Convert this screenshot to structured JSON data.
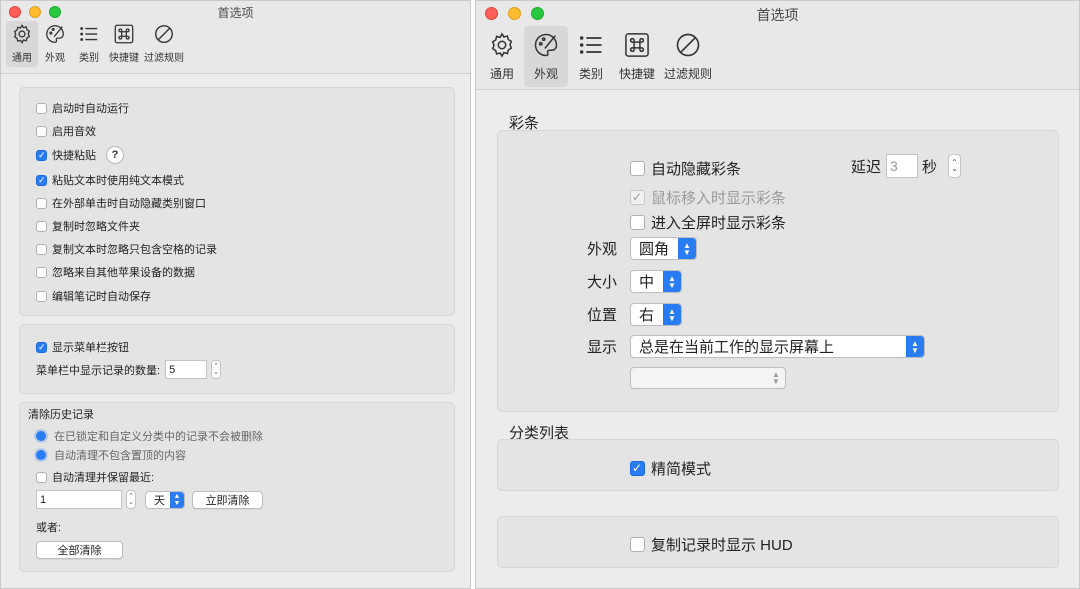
{
  "left": {
    "title": "首选项",
    "tabs": [
      {
        "label": "通用",
        "icon": "gear-icon"
      },
      {
        "label": "外观",
        "icon": "brush-palette-icon"
      },
      {
        "label": "类别",
        "icon": "list-icon"
      },
      {
        "label": "快捷键",
        "icon": "command-key-icon"
      },
      {
        "label": "过滤规则",
        "icon": "prohibited-icon"
      }
    ],
    "active_tab": "通用",
    "general": [
      {
        "label": "启动时自动运行",
        "checked": false
      },
      {
        "label": "启用音效",
        "checked": false
      },
      {
        "label": "快捷粘贴",
        "checked": true,
        "help": "?"
      },
      {
        "label": "粘贴文本时使用纯文本模式",
        "checked": true
      },
      {
        "label": "在外部单击时自动隐藏类别窗口",
        "checked": false
      },
      {
        "label": "复制时忽略文件夹",
        "checked": false
      },
      {
        "label": "复制文本时忽略只包含空格的记录",
        "checked": false
      },
      {
        "label": "忽略来自其他苹果设备的数据",
        "checked": false
      },
      {
        "label": "编辑笔记时自动保存",
        "checked": false
      }
    ],
    "menubar": {
      "show_label": "显示菜单栏按钮",
      "show_checked": true,
      "count_label": "菜单栏中显示记录的数量:",
      "count_value": "5"
    },
    "history": {
      "title": "清除历史记录",
      "note1": "在已锁定和自定义分类中的记录不会被删除",
      "note2": "自动清理不包含置顶的内容",
      "auto_label": "自动清理并保留最近:",
      "auto_checked": false,
      "keep_value": "1",
      "unit_value": "天",
      "clear_now_label": "立即清除",
      "or_label": "或者:",
      "clear_all_label": "全部清除"
    }
  },
  "right": {
    "title": "首选项",
    "tabs": [
      {
        "label": "通用",
        "icon": "gear-icon"
      },
      {
        "label": "外观",
        "icon": "brush-palette-icon"
      },
      {
        "label": "类别",
        "icon": "list-icon"
      },
      {
        "label": "快捷键",
        "icon": "command-key-icon"
      },
      {
        "label": "过滤规则",
        "icon": "prohibited-icon"
      }
    ],
    "active_tab": "外观",
    "ribbon": {
      "title": "彩条",
      "auto_hide_label": "自动隐藏彩条",
      "auto_hide_checked": false,
      "delay_label": "延迟",
      "delay_value": "3",
      "delay_unit": "秒",
      "hover_show_label": "鼠标移入时显示彩条",
      "hover_show_checked": true,
      "hover_show_disabled": true,
      "fullscreen_label": "进入全屏时显示彩条",
      "fullscreen_checked": false,
      "appearance_label": "外观",
      "appearance_value": "圆角",
      "size_label": "大小",
      "size_value": "中",
      "position_label": "位置",
      "position_value": "右",
      "display_label": "显示",
      "display_value": "总是在当前工作的显示屏幕上",
      "extra_value": ""
    },
    "category_list": {
      "title": "分类列表",
      "compact_label": "精简模式",
      "compact_checked": true
    },
    "hud": {
      "label": "复制记录时显示 HUD",
      "checked": false
    }
  },
  "colors": {
    "accent": "#2a7cf3",
    "close": "#fe5f57",
    "minimize": "#febc2e",
    "zoom": "#28c840"
  }
}
